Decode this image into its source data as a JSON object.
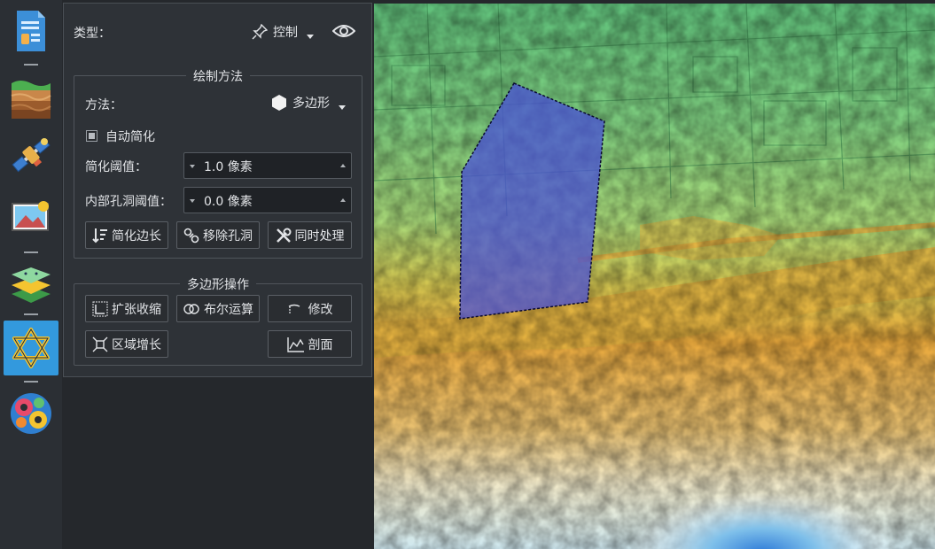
{
  "panel": {
    "type_label": "类型：",
    "type_value": "控制",
    "draw_group_title": "绘制方法",
    "method_label": "方法：",
    "method_value": "多边形",
    "auto_simplify_label": "自动简化",
    "auto_simplify_checked": true,
    "simplify_threshold_label": "简化阈值：",
    "simplify_threshold_value": "1.0 像素",
    "hole_threshold_label": "内部孔洞阈值：",
    "hole_threshold_value": "0.0 像素",
    "btn_simplify_edges": "简化边长",
    "btn_remove_holes": "移除孔洞",
    "btn_process_both": "同时处理",
    "polygon_ops_title": "多边形操作",
    "btn_expand_shrink": "扩张收缩",
    "btn_boolean": "布尔运算",
    "btn_modify": "修改",
    "btn_region_grow": "区域增长",
    "btn_profile": "剖面"
  },
  "toolbar": {
    "tools": [
      "document-icon",
      "terrain-layers-icon",
      "satellite-icon",
      "image-icon",
      "layers-stack-icon",
      "star-of-david-icon",
      "gears-icon"
    ],
    "active_tool": "star-of-david-icon"
  },
  "colors": {
    "accent": "#3399dd",
    "polygon_fill": "#4a50d8"
  }
}
